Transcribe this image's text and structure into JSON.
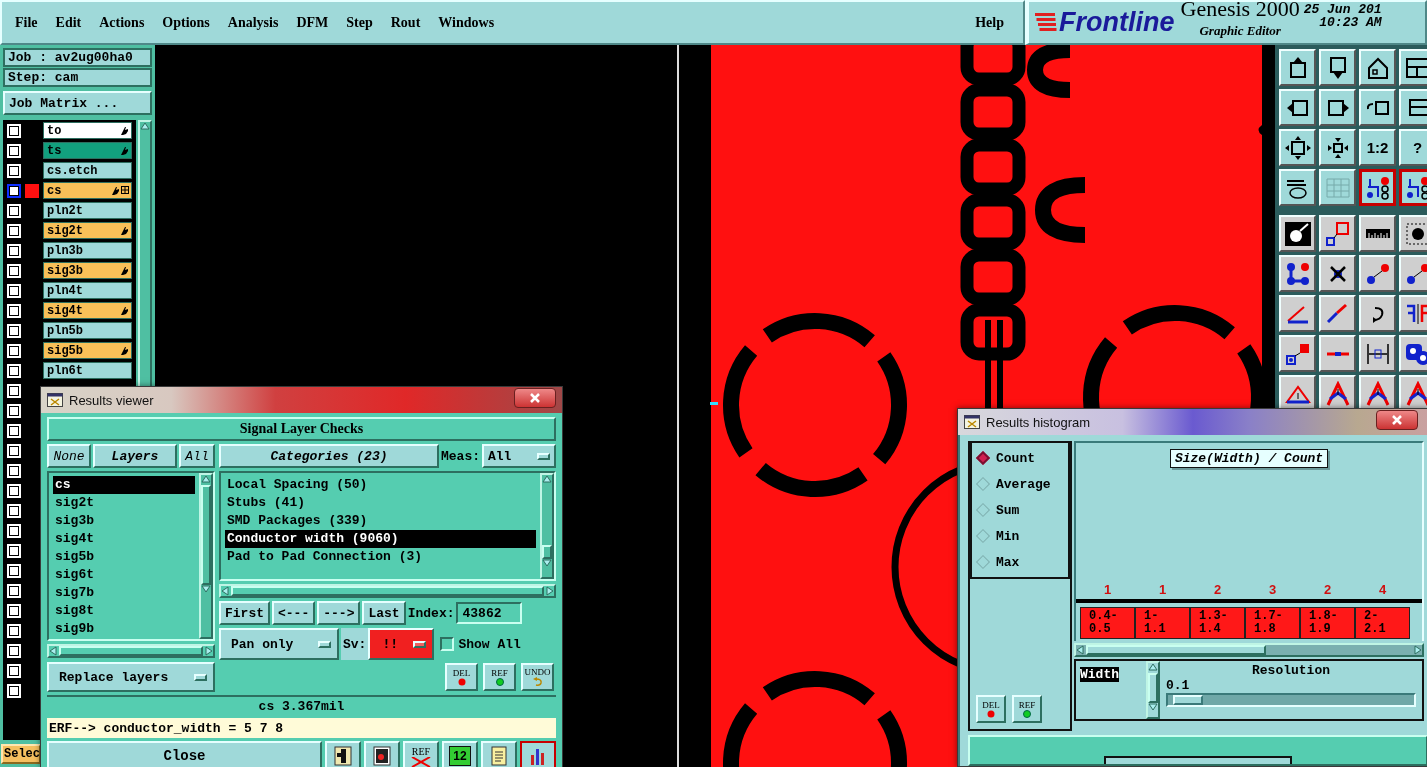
{
  "menu": [
    {
      "label": "File"
    },
    {
      "label": "Edit"
    },
    {
      "label": "Actions"
    },
    {
      "label": "Options"
    },
    {
      "label": "Analysis"
    },
    {
      "label": "DFM"
    },
    {
      "label": "Step"
    },
    {
      "label": "Rout"
    },
    {
      "label": "Windows"
    }
  ],
  "help": "Help",
  "brand": {
    "logo": "Frontline",
    "product": "Genesis 2000",
    "subtitle": "Graphic Editor",
    "date": "25 Jun 201",
    "time": "10:23 AM"
  },
  "job": {
    "job": "Job : av2ug00ha0",
    "step": "Step: cam",
    "matrix_button": "Job Matrix ..."
  },
  "layers": [
    {
      "name": "to",
      "color": "#ffffff",
      "checked": false,
      "selected": false,
      "affected": true
    },
    {
      "name": "ts",
      "color": "#12a07e",
      "checked": false,
      "selected": false,
      "affected": true
    },
    {
      "name": "cs.etch",
      "color": "#9fd9d9",
      "checked": false,
      "selected": false,
      "affected": false
    },
    {
      "name": "cs",
      "color": "#f8c058",
      "checked": false,
      "selected": true,
      "affected": true
    },
    {
      "name": "pln2t",
      "color": "#9fd9d9",
      "checked": false,
      "selected": false,
      "affected": false
    },
    {
      "name": "sig2t",
      "color": "#f8c058",
      "checked": false,
      "selected": false,
      "affected": true
    },
    {
      "name": "pln3b",
      "color": "#9fd9d9",
      "checked": false,
      "selected": false,
      "affected": false
    },
    {
      "name": "sig3b",
      "color": "#f8c058",
      "checked": false,
      "selected": false,
      "affected": true
    },
    {
      "name": "pln4t",
      "color": "#9fd9d9",
      "checked": false,
      "selected": false,
      "affected": false
    },
    {
      "name": "sig4t",
      "color": "#f8c058",
      "checked": false,
      "selected": false,
      "affected": true
    },
    {
      "name": "pln5b",
      "color": "#9fd9d9",
      "checked": false,
      "selected": false,
      "affected": false
    },
    {
      "name": "sig5b",
      "color": "#f8c058",
      "checked": false,
      "selected": false,
      "affected": true
    },
    {
      "name": "pln6t",
      "color": "#9fd9d9",
      "checked": false,
      "selected": false,
      "affected": false
    },
    {
      "checked": false
    },
    {
      "checked": false
    },
    {
      "checked": false
    },
    {
      "checked": false
    },
    {
      "checked": false
    },
    {
      "checked": false
    },
    {
      "checked": false
    },
    {
      "checked": false
    },
    {
      "checked": false
    },
    {
      "checked": false
    },
    {
      "checked": false
    },
    {
      "checked": false
    },
    {
      "checked": false
    },
    {
      "checked": false
    },
    {
      "checked": false
    },
    {
      "checked": false
    }
  ],
  "select_button": "Selec",
  "toolbar": [
    {
      "kind": "export",
      "selected": false
    },
    {
      "kind": "import",
      "selected": false
    },
    {
      "kind": "home",
      "selected": false
    },
    {
      "kind": "panes",
      "selected": false
    },
    {
      "kind": "left",
      "selected": false
    },
    {
      "kind": "right",
      "selected": false
    },
    {
      "kind": "undo",
      "selected": false
    },
    {
      "kind": "zigzag",
      "selected": false
    },
    {
      "kind": "expand",
      "selected": false
    },
    {
      "kind": "shrink",
      "selected": false
    },
    {
      "kind": "text",
      "label": "1:2",
      "selected": false
    },
    {
      "kind": "text",
      "label": "?",
      "selected": false
    },
    {
      "kind": "settings",
      "selected": false
    },
    {
      "kind": "grid",
      "selected": false
    },
    {
      "kind": "board",
      "selected": true
    },
    {
      "kind": "board",
      "selected": true
    },
    {
      "kind": "padfill",
      "selected": false
    },
    {
      "kind": "padoutline",
      "selected": false
    },
    {
      "kind": "ruler",
      "selected": false
    },
    {
      "kind": "paddashed",
      "selected": false
    },
    {
      "kind": "nodes",
      "selected": false
    },
    {
      "kind": "cross",
      "selected": false
    },
    {
      "kind": "connect",
      "selected": false
    },
    {
      "kind": "connect",
      "selected": false
    },
    {
      "kind": "angle",
      "selected": false
    },
    {
      "kind": "slope",
      "selected": false
    },
    {
      "kind": "rotate",
      "selected": false
    },
    {
      "kind": "mirror",
      "selected": false
    },
    {
      "kind": "padlink",
      "selected": false
    },
    {
      "kind": "segment",
      "selected": false
    },
    {
      "kind": "measure",
      "selected": false
    },
    {
      "kind": "blob",
      "selected": false
    },
    {
      "kind": "triangle",
      "selected": false
    },
    {
      "kind": "arch",
      "selected": false
    },
    {
      "kind": "arch",
      "selected": false
    },
    {
      "kind": "arch",
      "selected": false
    }
  ],
  "results_viewer": {
    "title": "Results viewer",
    "heading": "Signal Layer Checks",
    "none_button": "None",
    "layers_button": "Layers",
    "all_button": "All",
    "layer_list": [
      {
        "label": "cs",
        "selected": true
      },
      {
        "label": "sig2t",
        "selected": false
      },
      {
        "label": "sig3b",
        "selected": false
      },
      {
        "label": "sig4t",
        "selected": false
      },
      {
        "label": "sig5b",
        "selected": false
      },
      {
        "label": "sig6t",
        "selected": false
      },
      {
        "label": "sig7b",
        "selected": false
      },
      {
        "label": "sig8t",
        "selected": false
      },
      {
        "label": "sig9b",
        "selected": false
      }
    ],
    "categories_button": "Categories (23)",
    "meas_label": "Meas:",
    "meas_value": "All",
    "categories": [
      {
        "label": "Local Spacing (50)",
        "selected": false
      },
      {
        "label": "Stubs (41)",
        "selected": false
      },
      {
        "label": "SMD Packages (339)",
        "selected": false
      },
      {
        "label": "Conductor width (9060)",
        "selected": true
      },
      {
        "label": "Pad to Pad Connection (3)",
        "selected": false
      }
    ],
    "nav": [
      "First",
      "<---",
      "--->",
      "Last"
    ],
    "index_label": "Index:",
    "index_value": "43862",
    "mode": "Pan only",
    "sv_label": "Sv:",
    "sv_value": "!!",
    "show_all": {
      "label": "Show All",
      "checked": false
    },
    "replace": "Replace layers",
    "actions": [
      {
        "kind": "delete",
        "label": "DEL"
      },
      {
        "kind": "refresh",
        "label": "REF"
      },
      {
        "kind": "undo",
        "label": "UNDO"
      }
    ],
    "status": "cs 3.367mil",
    "erf": "ERF--> conductor_width = 5 7 8",
    "close": "Close",
    "bottom_tools": [
      {
        "kind": "figure",
        "selected": false
      },
      {
        "kind": "layer",
        "selected": false
      },
      {
        "kind": "crossed",
        "label": "REF",
        "selected": false
      },
      {
        "kind": "number",
        "label": "12",
        "selected": false
      },
      {
        "kind": "report",
        "selected": false
      },
      {
        "kind": "chart",
        "selected": true
      }
    ]
  },
  "histogram": {
    "title": "Results histogram",
    "modes": [
      {
        "label": "Count",
        "selected": true
      },
      {
        "label": "Average",
        "selected": false
      },
      {
        "label": "Sum",
        "selected": false
      },
      {
        "label": "Min",
        "selected": false
      },
      {
        "label": "Max",
        "selected": false
      }
    ],
    "chart_title": "Size(Width) / Count",
    "bins": [
      {
        "count": "1",
        "range": "0.4-0.5"
      },
      {
        "count": "1",
        "range": "1-1.1"
      },
      {
        "count": "2",
        "range": "1.3-1.4"
      },
      {
        "count": "3",
        "range": "1.7-1.8"
      },
      {
        "count": "2",
        "range": "1.8-1.9"
      },
      {
        "count": "4",
        "range": "2-2.1"
      }
    ],
    "fields": [
      {
        "label": "Width",
        "selected": true
      }
    ],
    "resolution_label": "Resolution",
    "resolution_value": "0.1",
    "resolution": {
      "level": 0.02
    },
    "actions": [
      {
        "kind": "delete",
        "label": "DEL"
      },
      {
        "kind": "refresh",
        "label": "REF"
      }
    ]
  }
}
